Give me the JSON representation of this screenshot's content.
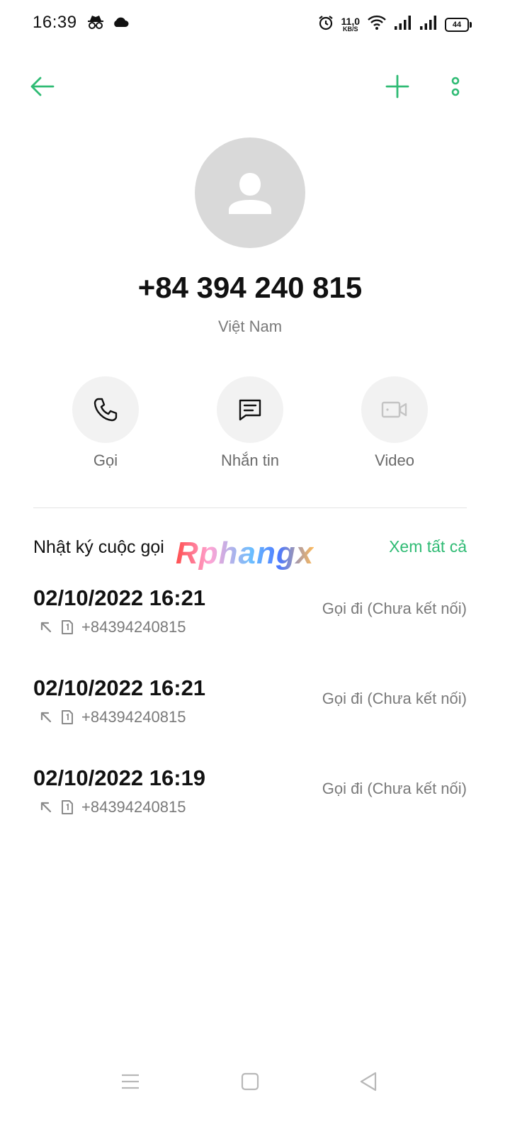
{
  "status_bar": {
    "time": "16:39",
    "net_speed": "11,0",
    "net_unit": "KB/S",
    "battery": "44"
  },
  "contact": {
    "phone": "+84 394 240 815",
    "country": "Việt Nam"
  },
  "actions": [
    {
      "label": "Gọi"
    },
    {
      "label": "Nhắn tin"
    },
    {
      "label": "Video"
    }
  ],
  "call_log": {
    "title": "Nhật ký cuộc gọi",
    "see_all": "Xem tất cả",
    "entries": [
      {
        "date": "02/10/2022 16:21",
        "number": "+84394240815",
        "status": "Gọi đi (Chưa kết nối)"
      },
      {
        "date": "02/10/2022 16:21",
        "number": "+84394240815",
        "status": "Gọi đi (Chưa kết nối)"
      },
      {
        "date": "02/10/2022 16:19",
        "number": "+84394240815",
        "status": "Gọi đi (Chưa kết nối)"
      }
    ]
  },
  "watermark": "Rphangx",
  "colors": {
    "accent": "#2fbb74",
    "text_secondary": "#7a7a7a",
    "avatar_bg": "#d9d9d9"
  },
  "icons": {
    "back": "arrow-left-icon",
    "add": "plus-icon",
    "more": "more-vertical-icon",
    "call": "phone-icon",
    "message": "message-icon",
    "video": "video-icon"
  }
}
